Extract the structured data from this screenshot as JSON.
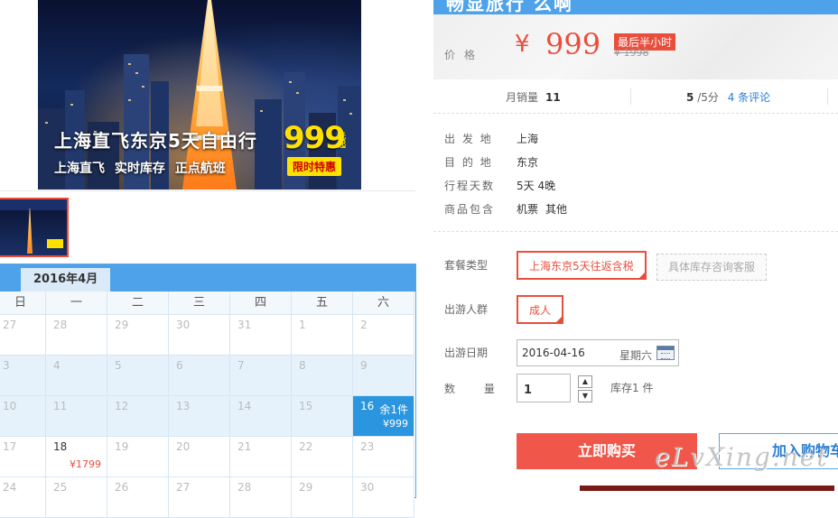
{
  "hero": {
    "title": "上海直飞东京5天自由行",
    "subtitle": "上海直飞   实时库存   正点航班",
    "price": "999",
    "price_unit": "元起",
    "badge": "限时特惠"
  },
  "product": {
    "title_partial": "畅显旅行 么啊"
  },
  "pricing": {
    "label": "价格",
    "currency": "¥",
    "price": "999",
    "promo": "最后半小时",
    "old_price": "¥ 1998"
  },
  "stats": {
    "sales_label": "月销量",
    "sales_value": "11",
    "rating_value": "5",
    "rating_suffix": "/5分",
    "reviews": "4 条评论"
  },
  "info": [
    {
      "label": "出 发 地",
      "value": "上海",
      "value2": ""
    },
    {
      "label": "目 的 地",
      "value": "东京",
      "value2": ""
    },
    {
      "label": "行程天数",
      "value": "5天 4晚",
      "value2": ""
    },
    {
      "label": "商品包含",
      "value": "机票",
      "value2": "其他"
    }
  ],
  "options": {
    "package_label": "套餐类型",
    "package_selected": "上海东京5天往返含税",
    "package_consult": "具体库存咨询客服",
    "group_label": "出游人群",
    "group_selected": "成人",
    "date_label": "出游日期",
    "date_value": "2016-04-16",
    "date_weekday": "星期六",
    "qty_label": "数  量",
    "qty_value": "1",
    "stock": "库存1 件"
  },
  "actions": {
    "buy": "立即购买",
    "cart": "加入购物车"
  },
  "calendar": {
    "month": "2016年4月",
    "dow": [
      "日",
      "一",
      "二",
      "三",
      "四",
      "五",
      "六"
    ],
    "rows": [
      [
        {
          "d": "27"
        },
        {
          "d": "28"
        },
        {
          "d": "29"
        },
        {
          "d": "30"
        },
        {
          "d": "31"
        },
        {
          "d": "1"
        },
        {
          "d": "2"
        }
      ],
      [
        {
          "d": "3"
        },
        {
          "d": "4"
        },
        {
          "d": "5"
        },
        {
          "d": "6"
        },
        {
          "d": "7"
        },
        {
          "d": "8"
        },
        {
          "d": "9"
        }
      ],
      [
        {
          "d": "10"
        },
        {
          "d": "11"
        },
        {
          "d": "12"
        },
        {
          "d": "13"
        },
        {
          "d": "14"
        },
        {
          "d": "15"
        },
        {
          "d": "16",
          "stock": "余1件",
          "price": "¥999",
          "state": "active"
        }
      ],
      [
        {
          "d": "17"
        },
        {
          "d": "18",
          "price": "¥1799",
          "state": "avail"
        },
        {
          "d": "19"
        },
        {
          "d": "20"
        },
        {
          "d": "21"
        },
        {
          "d": "22"
        },
        {
          "d": "23"
        }
      ],
      [
        {
          "d": "24"
        },
        {
          "d": "25"
        },
        {
          "d": "26"
        },
        {
          "d": "27"
        },
        {
          "d": "28"
        },
        {
          "d": "29"
        },
        {
          "d": "30"
        }
      ]
    ]
  },
  "watermark": "eLvXing.net",
  "colors": {
    "accent_red": "#e94e3c",
    "accent_blue": "#4da2ea",
    "link_blue": "#2b7fd3"
  }
}
